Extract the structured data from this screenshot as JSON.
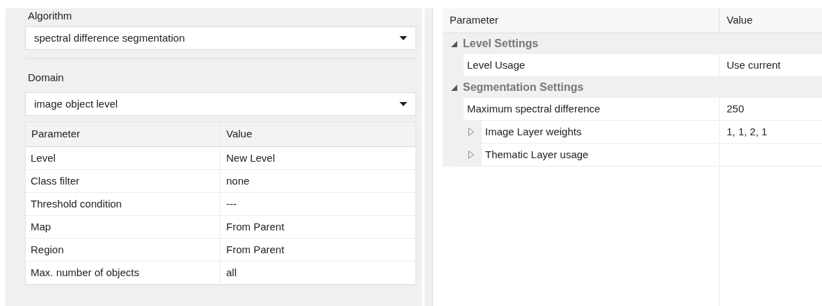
{
  "algorithm": {
    "label": "Algorithm",
    "value": "spectral difference segmentation"
  },
  "domain": {
    "label": "Domain",
    "value": "image object level",
    "table": {
      "columns": [
        "Parameter",
        "Value"
      ],
      "rows": [
        {
          "parameter": "Level",
          "value": "New Level"
        },
        {
          "parameter": "Class filter",
          "value": "none"
        },
        {
          "parameter": "Threshold condition",
          "value": "---"
        },
        {
          "parameter": "Map",
          "value": "From Parent"
        },
        {
          "parameter": "Region",
          "value": "From Parent"
        },
        {
          "parameter": "Max. number of objects",
          "value": "all"
        }
      ]
    }
  },
  "parameters": {
    "columns": [
      "Parameter",
      "Value"
    ],
    "groups": [
      {
        "label": "Level Settings",
        "expanded": true,
        "children": [
          {
            "parameter": "Level Usage",
            "value": "Use current"
          }
        ]
      },
      {
        "label": "Segmentation Settings",
        "expanded": true,
        "children": [
          {
            "parameter": "Maximum spectral difference",
            "value": "250"
          },
          {
            "parameter": "Image Layer weights",
            "value": "1, 1, 2, 1",
            "expanded": false
          },
          {
            "parameter": "Thematic Layer usage",
            "expanded": false
          }
        ]
      }
    ]
  }
}
